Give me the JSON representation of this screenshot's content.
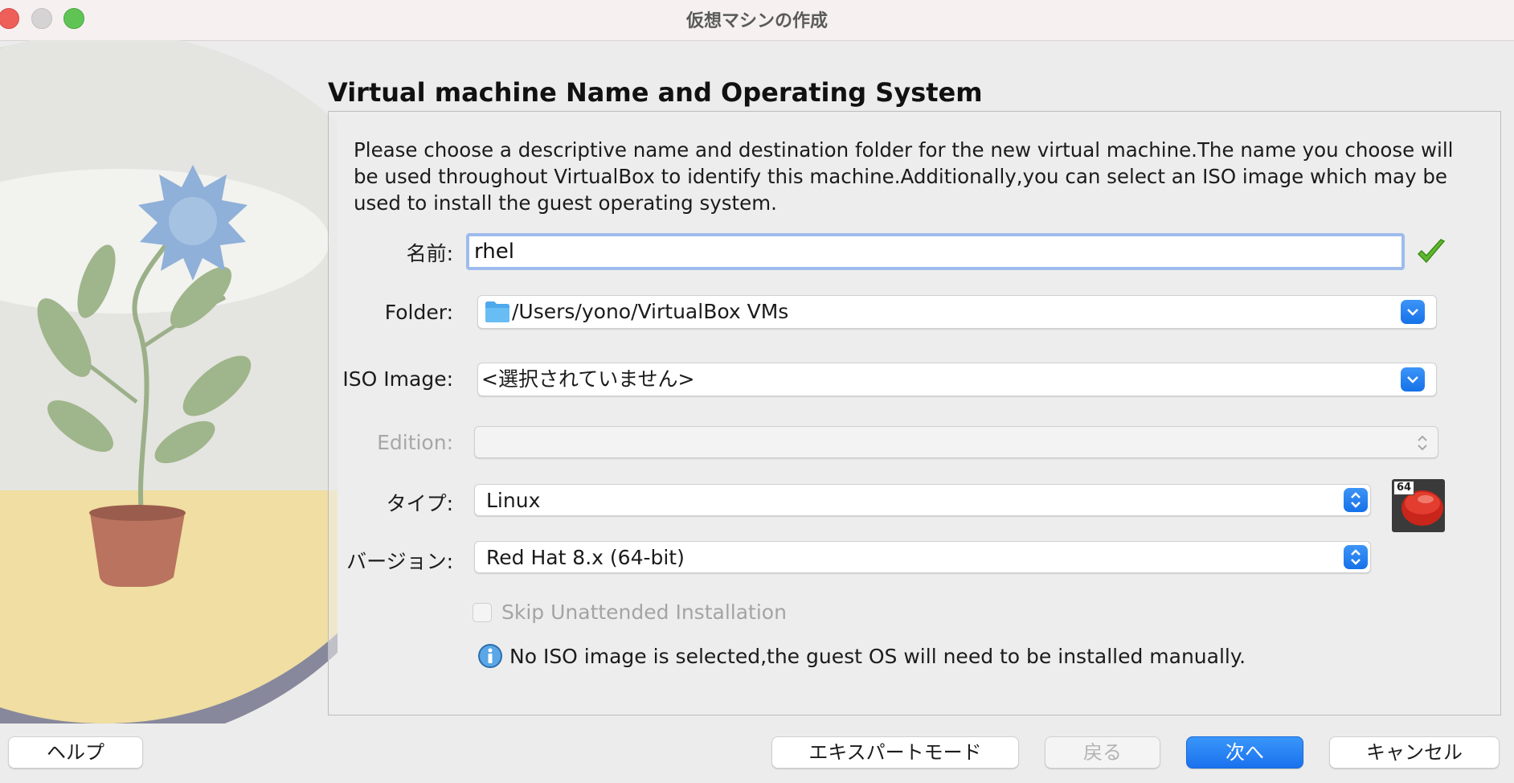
{
  "window": {
    "title": "仮想マシンの作成",
    "controls": [
      "close",
      "minimize",
      "maximize"
    ]
  },
  "page": {
    "heading": "Virtual machine Name and Operating System",
    "description": "Please choose a descriptive name and destination folder for the new virtual machine.The name you choose will be used throughout VirtualBox to identify this machine.Additionally,you can select an ISO image which may be used to install the guest operating system."
  },
  "form": {
    "name_label": "名前:",
    "name_value": "rhel",
    "name_valid_icon": "green-checkmark-icon",
    "folder_label": "Folder:",
    "folder_value": "/Users/yono/VirtualBox VMs",
    "iso_label": "ISO Image:",
    "iso_value": "<選択されていません>",
    "edition_label": "Edition:",
    "edition_value": "",
    "type_label": "タイプ:",
    "type_value": "Linux",
    "version_label": "バージョン:",
    "version_value": "Red Hat 8.x (64-bit)",
    "os_icon_badge": "64",
    "skip_label": "Skip Unattended Installation",
    "skip_checked": false,
    "info_text": "No ISO image is selected,the guest OS will need to be installed manually."
  },
  "buttons": {
    "help": "ヘルプ",
    "expert": "エキスパートモード",
    "back": "戻る",
    "next": "次へ",
    "cancel": "キャンセル"
  },
  "colors": {
    "accent": "#1a72ee",
    "focus_ring": "#9dbcec",
    "valid_check": "#5fb82e"
  }
}
